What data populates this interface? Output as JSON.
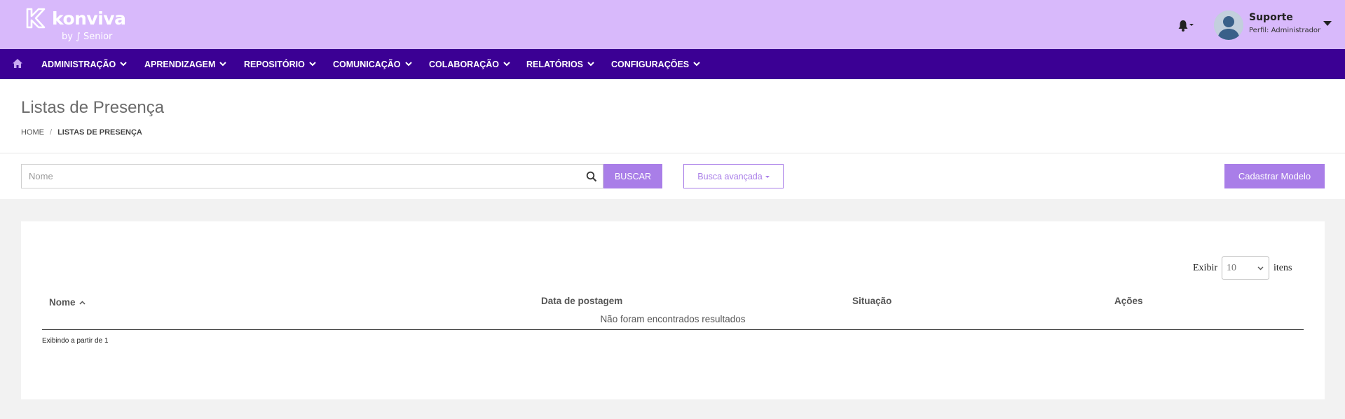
{
  "brand": {
    "name": "konviva",
    "byline": "by ∫ Senior"
  },
  "user": {
    "name": "Suporte",
    "role": "Perfil: Administrador"
  },
  "nav": {
    "items": [
      {
        "label": "ADMINISTRAÇÃO"
      },
      {
        "label": "APRENDIZAGEM"
      },
      {
        "label": "REPOSITÓRIO"
      },
      {
        "label": "COMUNICAÇÃO"
      },
      {
        "label": "COLABORAÇÃO"
      },
      {
        "label": "RELATÓRIOS"
      },
      {
        "label": "CONFIGURAÇÕES"
      }
    ]
  },
  "page": {
    "title": "Listas de Presença",
    "breadcrumb": {
      "home": "HOME",
      "separator": "/",
      "current": "LISTAS DE PRESENÇA"
    }
  },
  "search": {
    "placeholder": "Nome",
    "value": "",
    "button_label": "BUSCAR",
    "advanced_label": "Busca avançada"
  },
  "actions": {
    "create_label": "Cadastrar Modelo"
  },
  "table": {
    "show_label": "Exibir",
    "per_page": "10",
    "items_label": "itens",
    "columns": [
      {
        "label": "Nome"
      },
      {
        "label": "Data de postagem"
      },
      {
        "label": "Situação"
      },
      {
        "label": "Ações"
      }
    ],
    "empty_message": "Não foram encontrados resultados",
    "footer": "Exibindo a partir de 1"
  },
  "colors": {
    "header_bg": "#d8b9fb",
    "nav_bg": "#3b0094",
    "accent": "#a97ee8"
  }
}
